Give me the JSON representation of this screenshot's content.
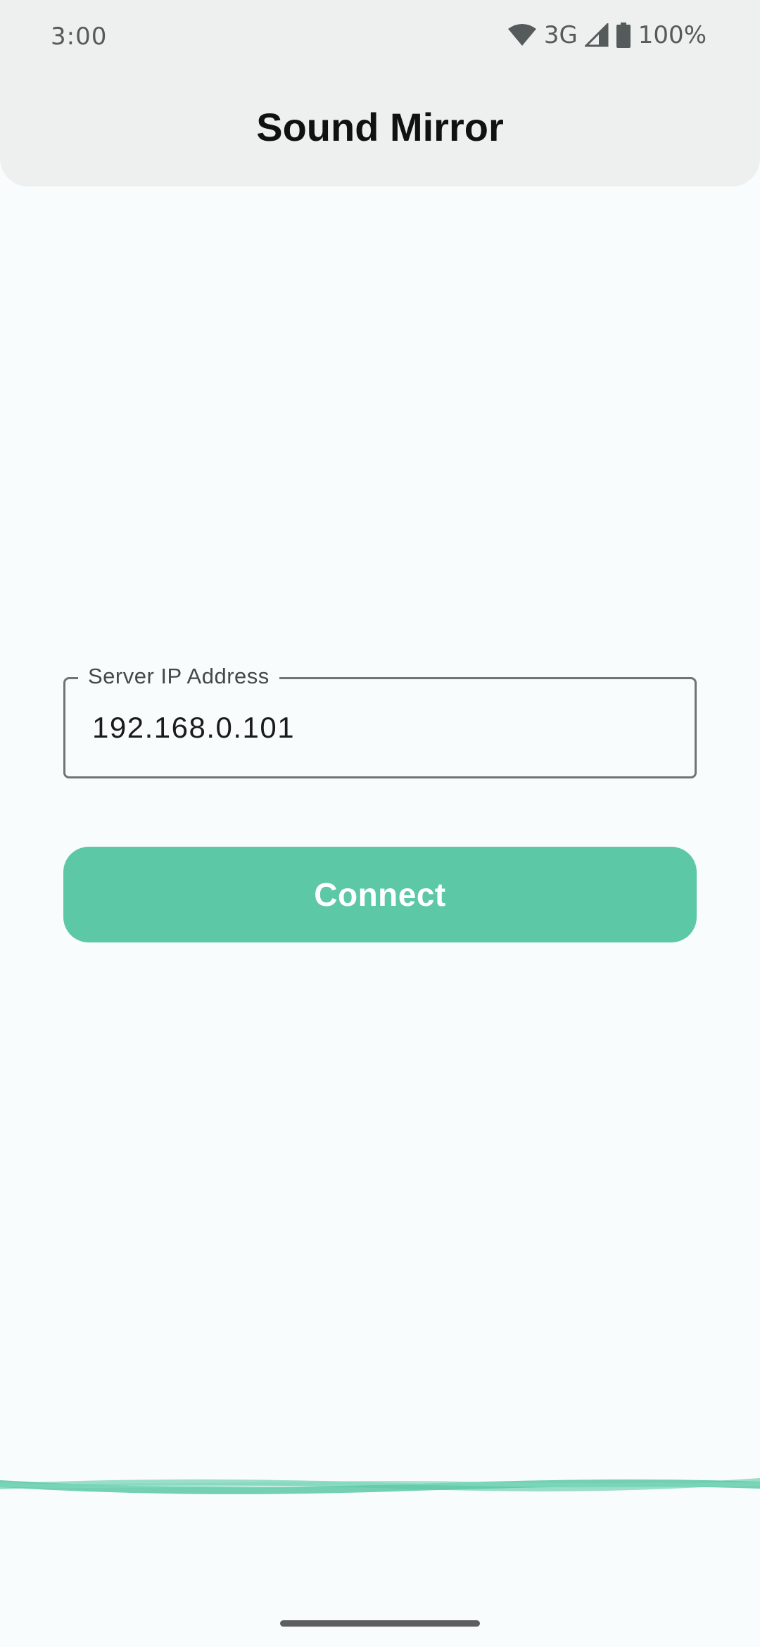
{
  "status_bar": {
    "time": "3:00",
    "network": "3G",
    "battery": "100%",
    "icons": [
      "wifi-icon",
      "signal-icon",
      "battery-icon"
    ]
  },
  "app": {
    "title": "Sound Mirror"
  },
  "ip_field": {
    "label": "Server IP Address",
    "value": "192.168.0.101"
  },
  "connect_button": {
    "label": "Connect"
  },
  "colors": {
    "accent": "#5cc8a5",
    "background": "#f8fcfc",
    "topbar": "#eef0ef"
  }
}
